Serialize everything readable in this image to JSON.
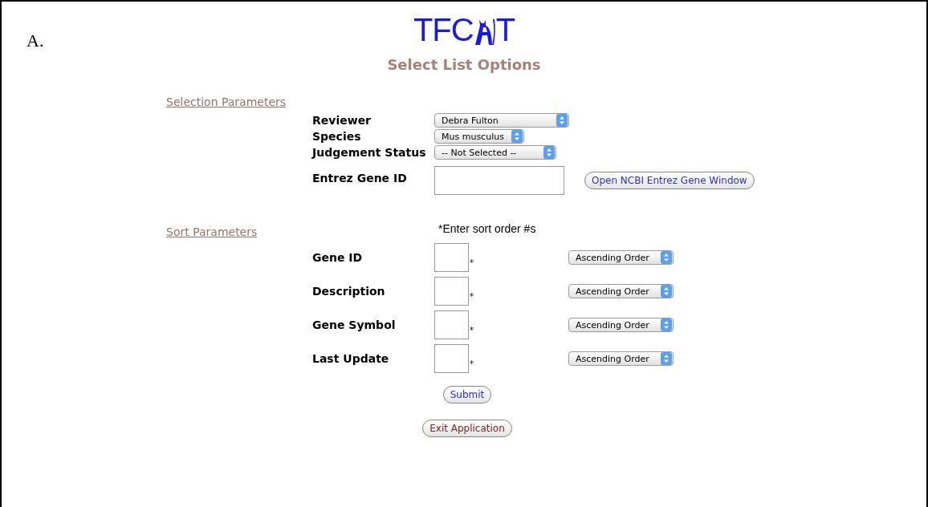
{
  "figure_label": "A.",
  "logo": {
    "prefix": "TFC",
    "suffix": "T"
  },
  "title": "Select List Options",
  "selection": {
    "heading": "Selection Parameters",
    "fields": [
      {
        "kind": "select",
        "label": "Reviewer",
        "value": "Debra Fulton"
      },
      {
        "kind": "select",
        "label": "Species",
        "value": "Mus musculus"
      },
      {
        "kind": "select",
        "label": "Judgement Status",
        "value": "-- Not Selected --"
      },
      {
        "kind": "text",
        "label": "Entrez Gene ID",
        "button": "Open NCBI Entrez Gene Window"
      }
    ]
  },
  "sort": {
    "heading": "Sort Parameters",
    "note": "*Enter sort order #s",
    "rows": [
      {
        "label": "Gene ID",
        "marker": "*",
        "order": "Ascending Order"
      },
      {
        "label": "Description",
        "marker": "*",
        "order": "Ascending Order"
      },
      {
        "label": "Gene Symbol",
        "marker": "*",
        "order": "Ascending Order"
      },
      {
        "label": "Last Update",
        "marker": "*",
        "order": "Ascending Order"
      }
    ]
  },
  "buttons": [
    {
      "kind": "submit",
      "label": "Submit"
    },
    {
      "kind": "exit",
      "label": "Exit Application"
    }
  ]
}
